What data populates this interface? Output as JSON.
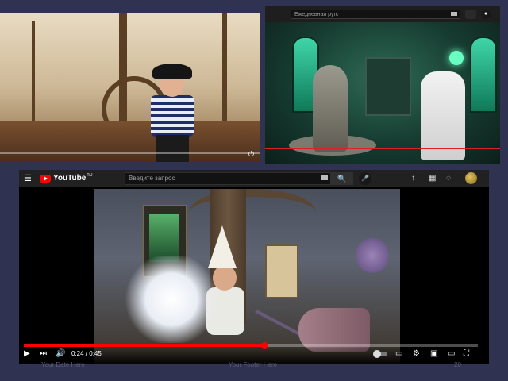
{
  "panel_pirate": {
    "controls": "⏻"
  },
  "panel_snake": {
    "search_placeholder": "Ежедневная ругс",
    "icons": [
      "keyboard-icon",
      "notifications-icon",
      "mic-icon"
    ]
  },
  "youtube": {
    "logo_text": "YouTube",
    "logo_suffix": "RU",
    "search_placeholder": "Введите запрос",
    "icons": {
      "menu": "☰",
      "search": "🔍",
      "mic": "🎤",
      "upload": "↑",
      "apps": "▦",
      "bell": "◌"
    },
    "player": {
      "time_current": "0:24",
      "time_total": "0:45",
      "time_label": "0:24 / 0:45",
      "progress_fraction": 0.53,
      "buttons": {
        "play": "▶",
        "next": "⏭",
        "volume": "🔊",
        "subtitles": "▭",
        "settings": "⚙",
        "miniplayer": "▣",
        "theater": "▭",
        "fullscreen": "⛶"
      }
    }
  },
  "footer": {
    "date": "Your Date Here",
    "footer_text": "Your Footer Here",
    "page": "20"
  },
  "colors": {
    "slide_bg": "#2f3250",
    "youtube_red": "#ff0000",
    "progress_red": "#e02020"
  }
}
